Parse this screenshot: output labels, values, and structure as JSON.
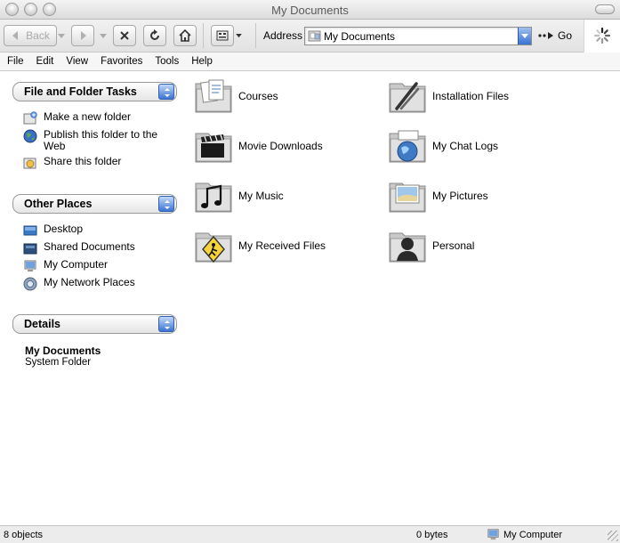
{
  "window": {
    "title": "My Documents"
  },
  "toolbar": {
    "back_label": "Back",
    "address_label": "Address",
    "address_value": "My Documents",
    "go_label": "Go"
  },
  "menu": [
    "File",
    "Edit",
    "View",
    "Favorites",
    "Tools",
    "Help"
  ],
  "sidebar": {
    "tasks": {
      "title": "File and Folder Tasks",
      "items": [
        {
          "label": "Make a new folder",
          "icon": "new-folder-icon"
        },
        {
          "label": "Publish this folder to the Web",
          "icon": "globe-icon"
        },
        {
          "label": "Share this folder",
          "icon": "share-folder-icon"
        }
      ]
    },
    "places": {
      "title": "Other Places",
      "items": [
        {
          "label": "Desktop",
          "icon": "desktop-icon"
        },
        {
          "label": "Shared Documents",
          "icon": "shared-folder-icon"
        },
        {
          "label": "My Computer",
          "icon": "computer-icon"
        },
        {
          "label": "My Network Places",
          "icon": "network-icon"
        }
      ]
    },
    "details": {
      "title": "Details",
      "name": "My Documents",
      "type": "System Folder"
    }
  },
  "folders": [
    {
      "name": "Courses",
      "icon": "documents-folder-icon"
    },
    {
      "name": "Installation Files",
      "icon": "tools-folder-icon"
    },
    {
      "name": "Movie Downloads",
      "icon": "movie-folder-icon"
    },
    {
      "name": "My Chat Logs",
      "icon": "web-folder-icon"
    },
    {
      "name": "My Music",
      "icon": "music-folder-icon"
    },
    {
      "name": "My Pictures",
      "icon": "pictures-folder-icon"
    },
    {
      "name": "My Received Files",
      "icon": "received-folder-icon"
    },
    {
      "name": "Personal",
      "icon": "person-folder-icon"
    }
  ],
  "status": {
    "objects": "8 objects",
    "size": "0 bytes",
    "zone": "My Computer"
  },
  "colors": {
    "accent_blue": "#3c74d2",
    "titlebar_gray": "#dcdcdc"
  }
}
